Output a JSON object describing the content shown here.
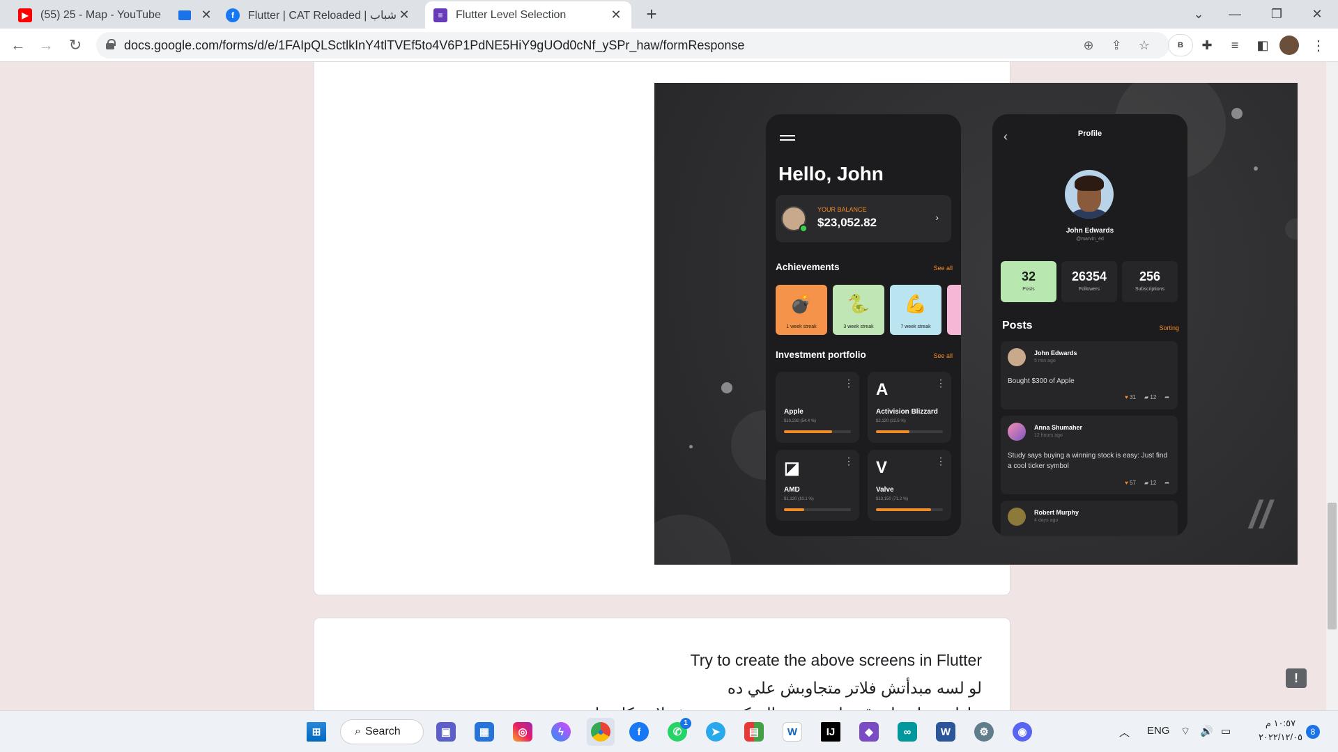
{
  "browser": {
    "tabs": [
      {
        "title": "(55) 25 - Map - YouTube",
        "icon": "youtube-icon",
        "color": "#ff0000"
      },
      {
        "title": "",
        "icon": "screen-share-icon",
        "color": "#1a73e8"
      },
      {
        "title": "Flutter | CAT Reloaded | م يا شباب",
        "icon": "facebook-icon",
        "color": "#1877f2"
      },
      {
        "title": "Flutter Level Selection",
        "icon": "google-forms-icon",
        "color": "#673ab7"
      }
    ],
    "new_tab": "+",
    "url": "docs.google.com/forms/d/e/1FAIpQLSctlkInY4tlTVEf5to4V6P1PdNE5HiY9gUOd0cNf_ySPr_haw/formResponse",
    "profile_badge": "B"
  },
  "mockup": {
    "home": {
      "greeting": "Hello, John",
      "balance_label": "YOUR BALANCE",
      "balance_value": "$23,052.82",
      "achievements_title": "Achievements",
      "see_all": "See all",
      "achievements": [
        {
          "label": "1 week streak",
          "emoji": "💣",
          "color": "#f5934a"
        },
        {
          "label": "3 week streak",
          "emoji": "🐍",
          "color": "#bfe6b4"
        },
        {
          "label": "7 week streak",
          "emoji": "💪",
          "color": "#b9e4f0"
        }
      ],
      "portfolio_title": "Investment portfolio",
      "investments": [
        {
          "name": "Apple",
          "logo": "",
          "sub": "$10,230 (54.4 %)",
          "progress": 0.72
        },
        {
          "name": "Activision Blizzard",
          "logo": "A",
          "sub": "$2,120 (32.5 %)",
          "progress": 0.5
        },
        {
          "name": "AMD",
          "logo": "◪",
          "sub": "$1,120 (10.1 %)",
          "progress": 0.3
        },
        {
          "name": "Valve",
          "logo": "V",
          "sub": "$13,150 (71.2 %)",
          "progress": 0.82
        }
      ]
    },
    "profile": {
      "title": "Profile",
      "name": "John Edwards",
      "handle": "@marvin_ed",
      "stats": [
        {
          "value": "32",
          "label": "Posts"
        },
        {
          "value": "26354",
          "label": "Followers"
        },
        {
          "value": "256",
          "label": "Subscriptions"
        }
      ],
      "posts_title": "Posts",
      "sorting": "Sorting",
      "posts": [
        {
          "author": "John Edwards",
          "time": "5 min ago",
          "text": "Bought $300 of Apple",
          "likes": "31",
          "comments": "12"
        },
        {
          "author": "Anna Shumaher",
          "time": "12 hours ago",
          "text": "Study says buying a winning stock is easy: Just find a cool ticker symbol",
          "likes": "57",
          "comments": "12"
        },
        {
          "author": "Robert Murphy",
          "time": "4 days ago",
          "text": "",
          "likes": "",
          "comments": ""
        }
      ]
    }
  },
  "question": {
    "line1": "Try to create the above screens in Flutter",
    "line2": "لو لسه مبدأتش فلاتر متجاوبش علي ده",
    "line3": "حاول تعمل علي قد ما تقدر من السكرينتين مش لازم كل حاجة"
  },
  "taskbar": {
    "search_label": "Search",
    "language": "ENG",
    "time": "١٠:٥٧ م",
    "date": "٢٠٢٢/١٢/٠٥",
    "notifications": "8",
    "whatsapp_badge": "1"
  }
}
